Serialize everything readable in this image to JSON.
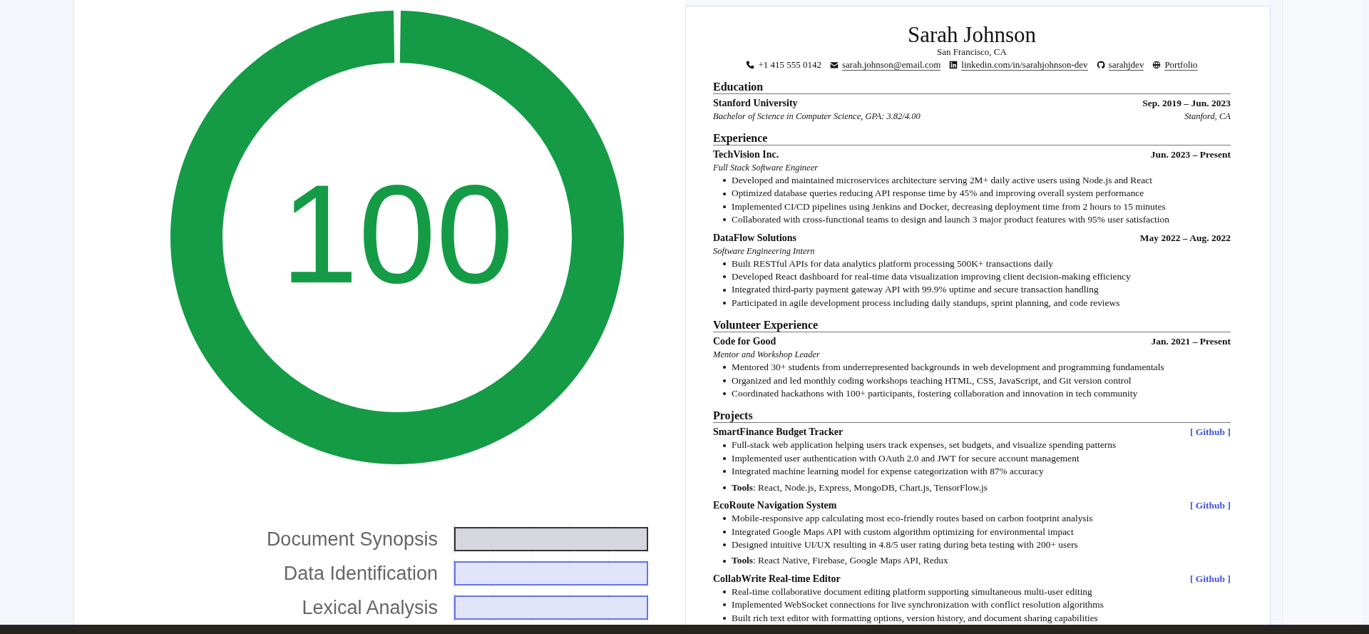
{
  "score": {
    "value": "100",
    "level": 1
  },
  "sections_chart": {
    "rows": [
      {
        "label": "Document Synopsis",
        "level": 1,
        "selected": true
      },
      {
        "label": "Data Identification",
        "level": 1,
        "selected": false
      },
      {
        "label": "Lexical Analysis",
        "level": 1,
        "selected": false
      }
    ]
  },
  "resume": {
    "name": "Sarah Johnson",
    "location": "San Francisco, CA",
    "contacts": [
      {
        "kind": "phone",
        "text": "+1 415 555 0142",
        "link": false
      },
      {
        "kind": "email",
        "text": "sarah.johnson@email.com",
        "link": true
      },
      {
        "kind": "linkedin",
        "text": "linkedin.com/in/sarahjohnson-dev",
        "link": true
      },
      {
        "kind": "github",
        "text": "sarahjdev",
        "link": true
      },
      {
        "kind": "web",
        "text": "Portfolio",
        "link": true
      }
    ],
    "sections": [
      {
        "title": "Education",
        "entries": [
          {
            "title": "Stanford University",
            "date": "Sep. 2019 – Jun. 2023",
            "subtitle": "Bachelor of Science in Computer Science, GPA: 3.82/4.00",
            "place": "Stanford, CA"
          }
        ]
      },
      {
        "title": "Experience",
        "entries": [
          {
            "title": "TechVision Inc.",
            "date": "Jun. 2023 – Present",
            "subtitle": "Full Stack Software Engineer",
            "bullets": [
              "Developed and maintained microservices architecture serving 2M+ daily active users using Node.js and React",
              "Optimized database queries reducing API response time by 45% and improving overall system performance",
              "Implemented CI/CD pipelines using Jenkins and Docker, decreasing deployment time from 2 hours to 15 minutes",
              "Collaborated with cross-functional teams to design and launch 3 major product features with 95% user satisfaction"
            ]
          },
          {
            "title": "DataFlow Solutions",
            "date": "May 2022 – Aug. 2022",
            "subtitle": "Software Engineering Intern",
            "bullets": [
              "Built RESTful APIs for data analytics platform processing 500K+ transactions daily",
              "Developed React dashboard for real-time data visualization improving client decision-making efficiency",
              "Integrated third-party payment gateway API with 99.9% uptime and secure transaction handling",
              "Participated in agile development process including daily standups, sprint planning, and code reviews"
            ]
          }
        ]
      },
      {
        "title": "Volunteer Experience",
        "entries": [
          {
            "title": "Code for Good",
            "date": "Jan. 2021 – Present",
            "subtitle": "Mentor and Workshop Leader",
            "bullets": [
              "Mentored 30+ students from underrepresented backgrounds in web development and programming fundamentals",
              "Organized and led monthly coding workshops teaching HTML, CSS, JavaScript, and Git version control",
              "Coordinated hackathons with 100+ participants, fostering collaboration and innovation in tech community"
            ]
          }
        ]
      },
      {
        "title": "Projects",
        "entries": [
          {
            "title": "SmartFinance Budget Tracker",
            "link": "[ Github ]",
            "bullets": [
              "Full-stack web application helping users track expenses, set budgets, and visualize spending patterns",
              "Implemented user authentication with OAuth 2.0 and JWT for secure account management",
              "Integrated machine learning model for expense categorization with 87% accuracy"
            ],
            "tools": "**Tools**: React, Node.js, Express, MongoDB, Chart.js, TensorFlow.js"
          },
          {
            "title": "EcoRoute Navigation System",
            "link": "[ Github ]",
            "bullets": [
              "Mobile-responsive app calculating most eco-friendly routes based on carbon footprint analysis",
              "Integrated Google Maps API with custom algorithm optimizing for environmental impact",
              "Designed intuitive UI/UX resulting in 4.8/5 user rating during beta testing with 200+ users"
            ],
            "tools": "**Tools**: React Native, Firebase, Google Maps API, Redux"
          },
          {
            "title": "CollabWrite Real-time Editor",
            "link": "[ Github ]",
            "bullets": [
              "Real-time collaborative document editing platform supporting simultaneous multi-user editing",
              "Implemented WebSocket connections for live synchronization with conflict resolution algorithms",
              "Built rich text editor with formatting options, version history, and document sharing capabilities"
            ]
          }
        ]
      }
    ]
  }
}
